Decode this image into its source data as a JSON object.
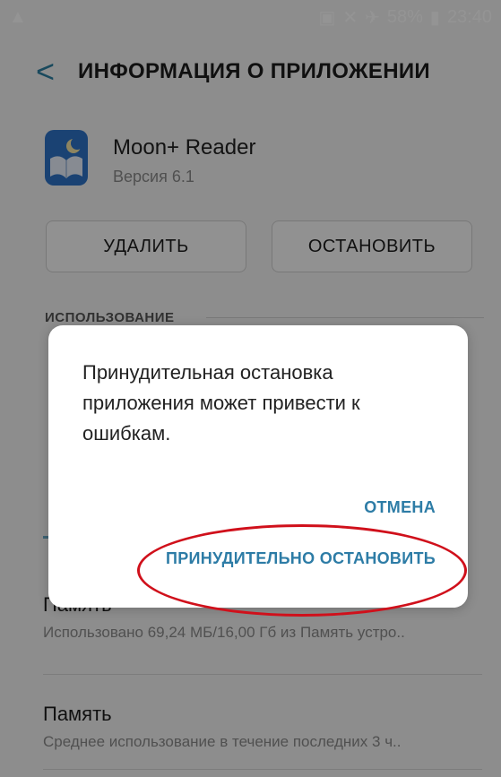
{
  "status": {
    "icons": [
      "warning-icon",
      "cast-icon",
      "mute-icon",
      "airplane-icon",
      "battery-icon"
    ],
    "battery": "58%",
    "time": "23:40"
  },
  "appbar": {
    "back_label": "<",
    "title": "ИНФОРМАЦИЯ О ПРИЛОЖЕНИИ"
  },
  "app": {
    "name": "Moon+ Reader",
    "version": "Версия 6.1",
    "icon": "moon-reader-icon"
  },
  "buttons": {
    "uninstall": "УДАЛИТЬ",
    "stop": "ОСТАНОВИТЬ"
  },
  "usage": {
    "label": "ИСПОЛЬЗОВАНИЕ"
  },
  "storage": {
    "title": "Память",
    "subtitle": "Использовано 69,24 МБ/16,00 Гб из Память устро.."
  },
  "memory": {
    "title": "Память",
    "subtitle": "Среднее использование в течение последних 3 ч.."
  },
  "dialog": {
    "message": "Принудительная остановка приложения может привести к ошибкам.",
    "cancel": "ОТМЕНА",
    "force_stop": "ПРИНУДИТЕЛЬНО ОСТАНОВИТЬ"
  },
  "colors": {
    "accent": "#2d7ca6",
    "highlight": "#d0101b"
  }
}
